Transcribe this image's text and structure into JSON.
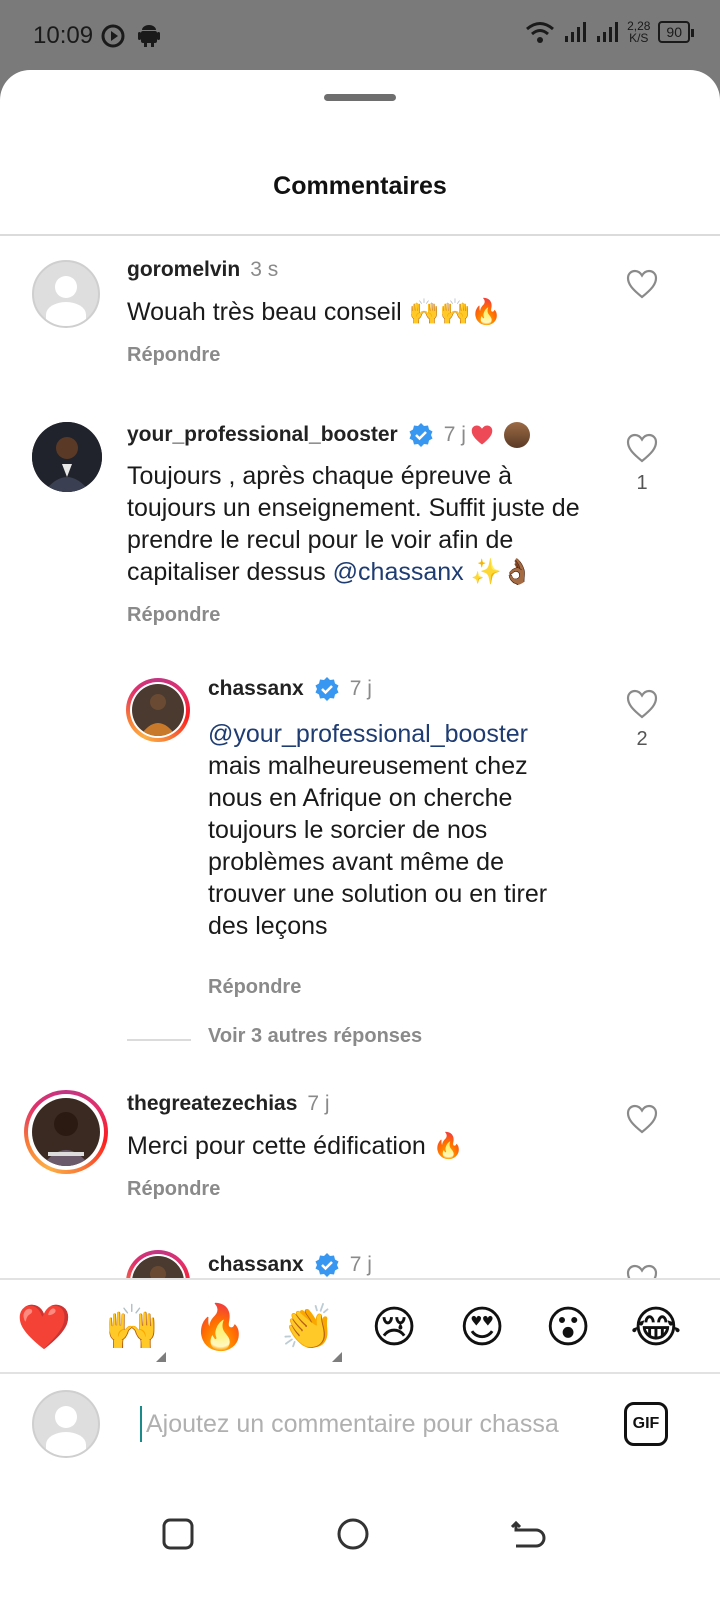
{
  "status_bar": {
    "time": "10:09",
    "speed_top": "2,28",
    "speed_bottom": "K/S",
    "battery": "90"
  },
  "sheet": {
    "title": "Commentaires"
  },
  "comments": [
    {
      "username": "goromelvin",
      "time": "3 s",
      "text": "Wouah très beau conseil 🙌🙌🔥",
      "reply": "Répondre"
    },
    {
      "username": "your_professional_booster",
      "time": "7 j",
      "text": "Toujours , après chaque épreuve à toujours un enseignement. Suffit juste de prendre le recul pour le voir afin de capitaliser dessus",
      "mention": "@chassanx",
      "text_end": " ✨👌🏾",
      "likes": "1",
      "reply": "Répondre"
    },
    {
      "username": "chassanx",
      "time": "7 j",
      "mention": "@your_professional_booster",
      "text": "mais malheureusement chez nous en Afrique on cherche toujours le sorcier de nos problèmes avant même de trouver une solution ou en tirer des leçons",
      "likes": "2",
      "reply": "Répondre"
    },
    {
      "more_replies": "Voir 3 autres réponses"
    },
    {
      "username": "thegreatezechias",
      "time": "7 j",
      "text": "Merci pour cette édification 🔥",
      "reply": "Répondre"
    },
    {
      "username": "chassanx",
      "time": "7 j"
    }
  ],
  "reactions": [
    "❤️",
    "🙌",
    "🔥",
    "👏",
    "😢",
    "😍",
    "😮",
    "😂"
  ],
  "composer": {
    "placeholder": "Ajoutez un commentaire pour chassa",
    "gif_label": "GIF"
  },
  "colors": {
    "verified": "#3897f0",
    "heart_red": "#ed4956",
    "mention": "#1e3c72"
  }
}
